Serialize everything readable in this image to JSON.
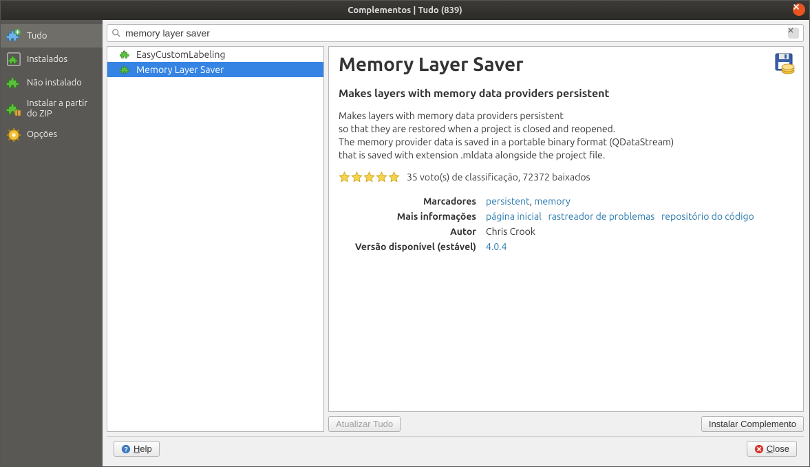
{
  "window": {
    "title": "Complementos | Tudo (839)"
  },
  "sidebar": {
    "items": [
      {
        "id": "tudo",
        "label": "Tudo",
        "icon": "puzzle-plus-blue",
        "selected": true
      },
      {
        "id": "instalados",
        "label": "Instalados",
        "icon": "puzzle-green-border",
        "selected": false
      },
      {
        "id": "nao-instalado",
        "label": "Não instalado",
        "icon": "puzzle-green",
        "selected": false
      },
      {
        "id": "instalar-zip",
        "label": "Instalar a partir do ZIP",
        "icon": "puzzle-zip",
        "selected": false
      },
      {
        "id": "opcoes",
        "label": "Opções",
        "icon": "gear-yellow",
        "selected": false
      }
    ]
  },
  "search": {
    "value": "memory layer saver",
    "placeholder": ""
  },
  "results": {
    "items": [
      {
        "id": "easycustomlabeling",
        "label": "EasyCustomLabeling",
        "selected": false
      },
      {
        "id": "memorylayersaver",
        "label": "Memory Layer Saver",
        "selected": true
      }
    ]
  },
  "detail": {
    "title": "Memory Layer Saver",
    "subtitle": "Makes layers with memory data providers persistent",
    "description": "Makes layers with memory data providers persistent\nso that they are restored when a project is closed and reopened.\nThe memory provider data is saved in a portable binary format (QDataStream)\nthat is saved with extension .mldata alongside the project file.",
    "rating_text": "35 voto(s) de classificação, 72372 baixados",
    "stars": 5,
    "meta": {
      "tags_label": "Marcadores",
      "tags": [
        {
          "text": "persistent"
        },
        {
          "text": "memory"
        }
      ],
      "moreinfo_label": "Mais informações",
      "moreinfo_links": [
        {
          "text": "página inicial"
        },
        {
          "text": "rastreador de problemas"
        },
        {
          "text": "repositório do código"
        }
      ],
      "author_label": "Autor",
      "author": "Chris Crook",
      "version_label": "Versão disponível (estável)",
      "version": "4.0.4"
    }
  },
  "buttons": {
    "update_all": "Atualizar Tudo",
    "install": "Instalar Complemento",
    "help": "Help",
    "close": "Close"
  }
}
